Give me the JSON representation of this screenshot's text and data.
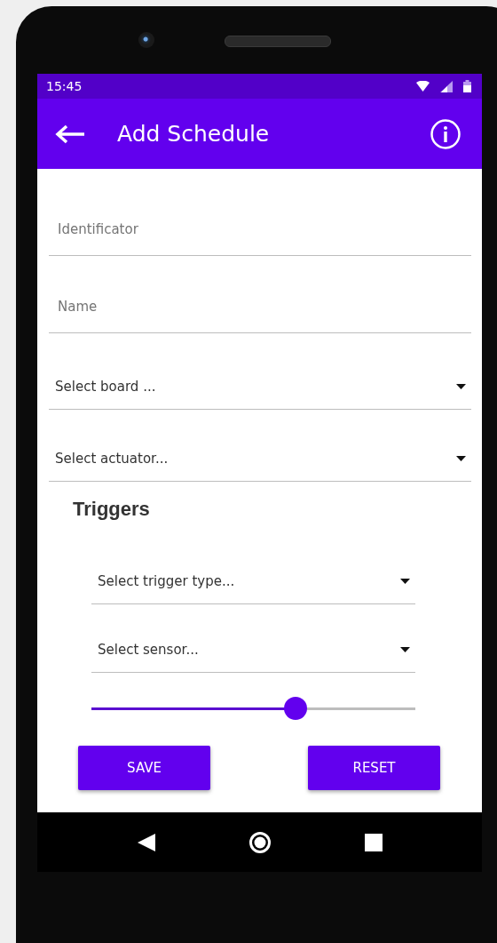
{
  "status_bar": {
    "time": "15:45"
  },
  "app_bar": {
    "title": "Add Schedule"
  },
  "fields": [
    {
      "kind": "text",
      "placeholder": "Identificator"
    },
    {
      "kind": "text",
      "placeholder": "Name"
    },
    {
      "kind": "dropdown",
      "placeholder": "Select board ..."
    },
    {
      "kind": "dropdown",
      "placeholder": "Select actuator..."
    }
  ],
  "triggers": {
    "heading": "Triggers",
    "fields": [
      {
        "kind": "dropdown",
        "placeholder": "Select trigger type..."
      },
      {
        "kind": "dropdown",
        "placeholder": "Select sensor..."
      }
    ],
    "slider": {
      "level": 0.63
    }
  },
  "buttons": [
    "SAVE",
    "RESET"
  ]
}
